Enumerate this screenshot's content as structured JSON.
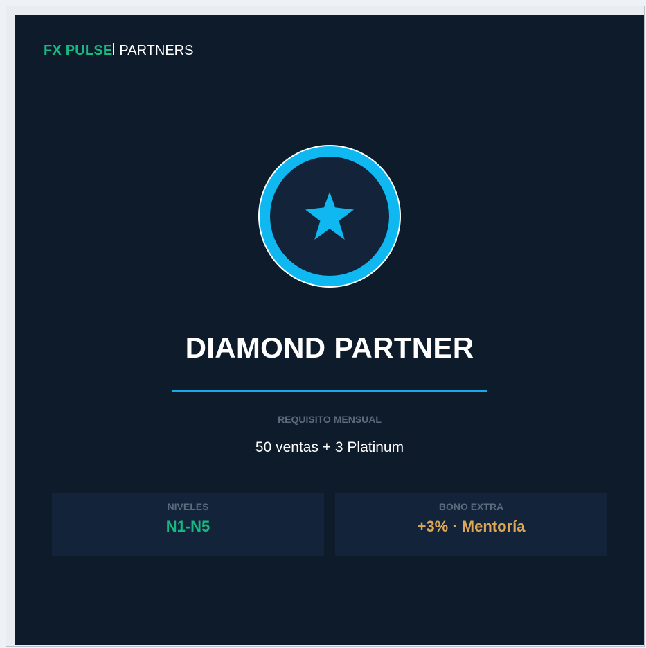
{
  "brand": {
    "primary": "FX PULSE",
    "secondary": "PARTNERS"
  },
  "medal": {
    "icon": "star-icon",
    "ring_color": "#0fb8f0",
    "inner_color": "#13243a"
  },
  "tier": {
    "title": "DIAMOND PARTNER"
  },
  "requirement": {
    "label": "REQUISITO MENSUAL",
    "value": "50 ventas + 3 Platinum"
  },
  "stats": [
    {
      "label": "NIVELES",
      "value": "N1-N5",
      "color": "#16b982"
    },
    {
      "label": "BONO EXTRA",
      "value": "+3% · Mentoría",
      "color": "#d9a757"
    }
  ],
  "colors": {
    "background": "#0d1b2a",
    "accent_green": "#16b982",
    "accent_blue": "#17a9e8",
    "accent_gold": "#d9a757"
  }
}
